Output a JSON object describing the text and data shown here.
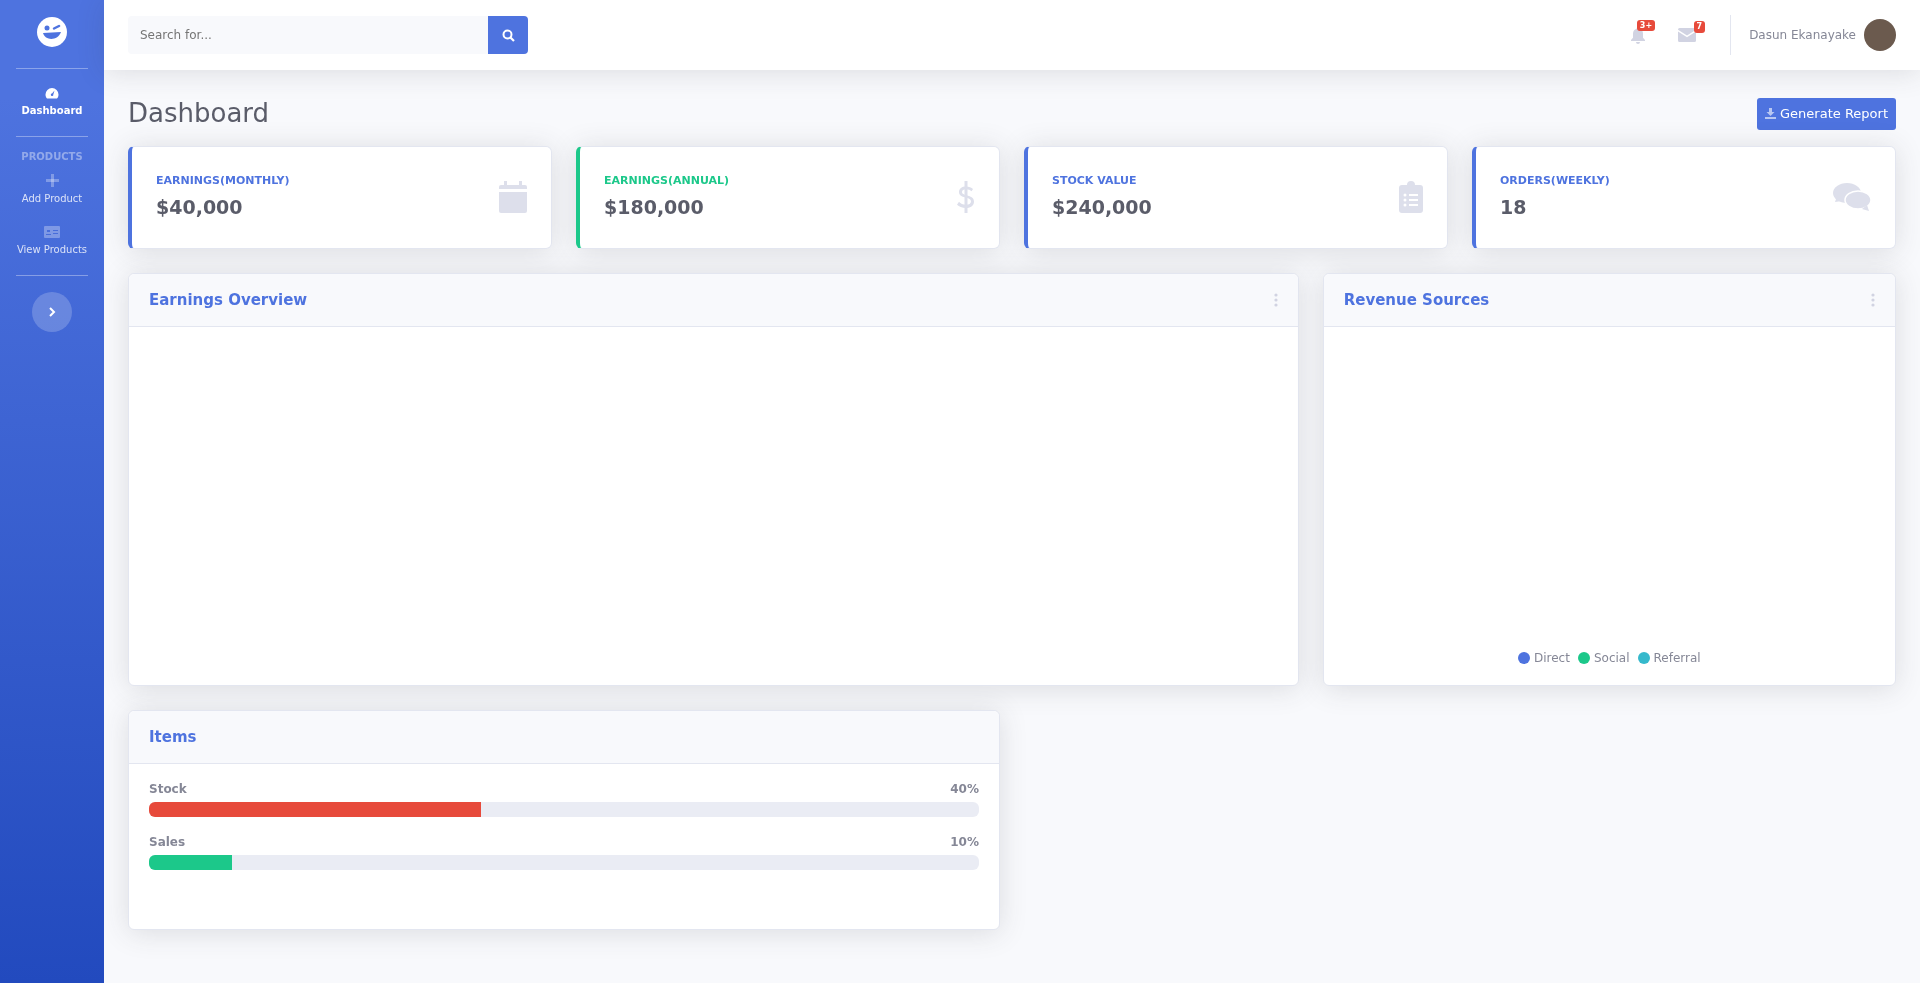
{
  "sidebar": {
    "items": [
      {
        "kind": "link",
        "label": "Dashboard",
        "selected": true
      },
      {
        "kind": "heading",
        "label": "PRODUCTS"
      },
      {
        "kind": "link",
        "label": "Add Product",
        "selected": false
      },
      {
        "kind": "link",
        "label": "View Products",
        "selected": false
      }
    ]
  },
  "topbar": {
    "search": {
      "placeholder": "Search for..."
    },
    "alerts_badge": "3+",
    "messages_badge": "7",
    "user_name": "Dasun Ekanayake"
  },
  "page": {
    "title": "Dashboard",
    "action": "Generate Report"
  },
  "stats": [
    {
      "label": "EARNINGS(MONTHLY)",
      "value": "$40,000",
      "color": "#4e73df"
    },
    {
      "label": "EARNINGS(ANNUAL)",
      "value": "$180,000",
      "color": "#1cc88a"
    },
    {
      "label": "STOCK VALUE",
      "value": "$240,000",
      "color": "#4e73df"
    },
    {
      "label": "ORDERS(WEEKLY)",
      "value": "18",
      "color": "#4e73df"
    }
  ],
  "earnings_overview": {
    "title": "Earnings Overview"
  },
  "revenue_sources": {
    "title": "Revenue Sources",
    "legend": [
      {
        "label": "Direct",
        "color": "#4e73df"
      },
      {
        "label": "Social",
        "color": "#1cc88a"
      },
      {
        "label": "Referral",
        "color": "#36b9cc"
      }
    ]
  },
  "items": {
    "title": "Items",
    "bars": [
      {
        "label": "Stock",
        "reading": "40%",
        "level": 0.4,
        "color": "#e74a3b"
      },
      {
        "label": "Sales",
        "reading": "10%",
        "level": 0.1,
        "color": "#1cc88a"
      }
    ]
  }
}
